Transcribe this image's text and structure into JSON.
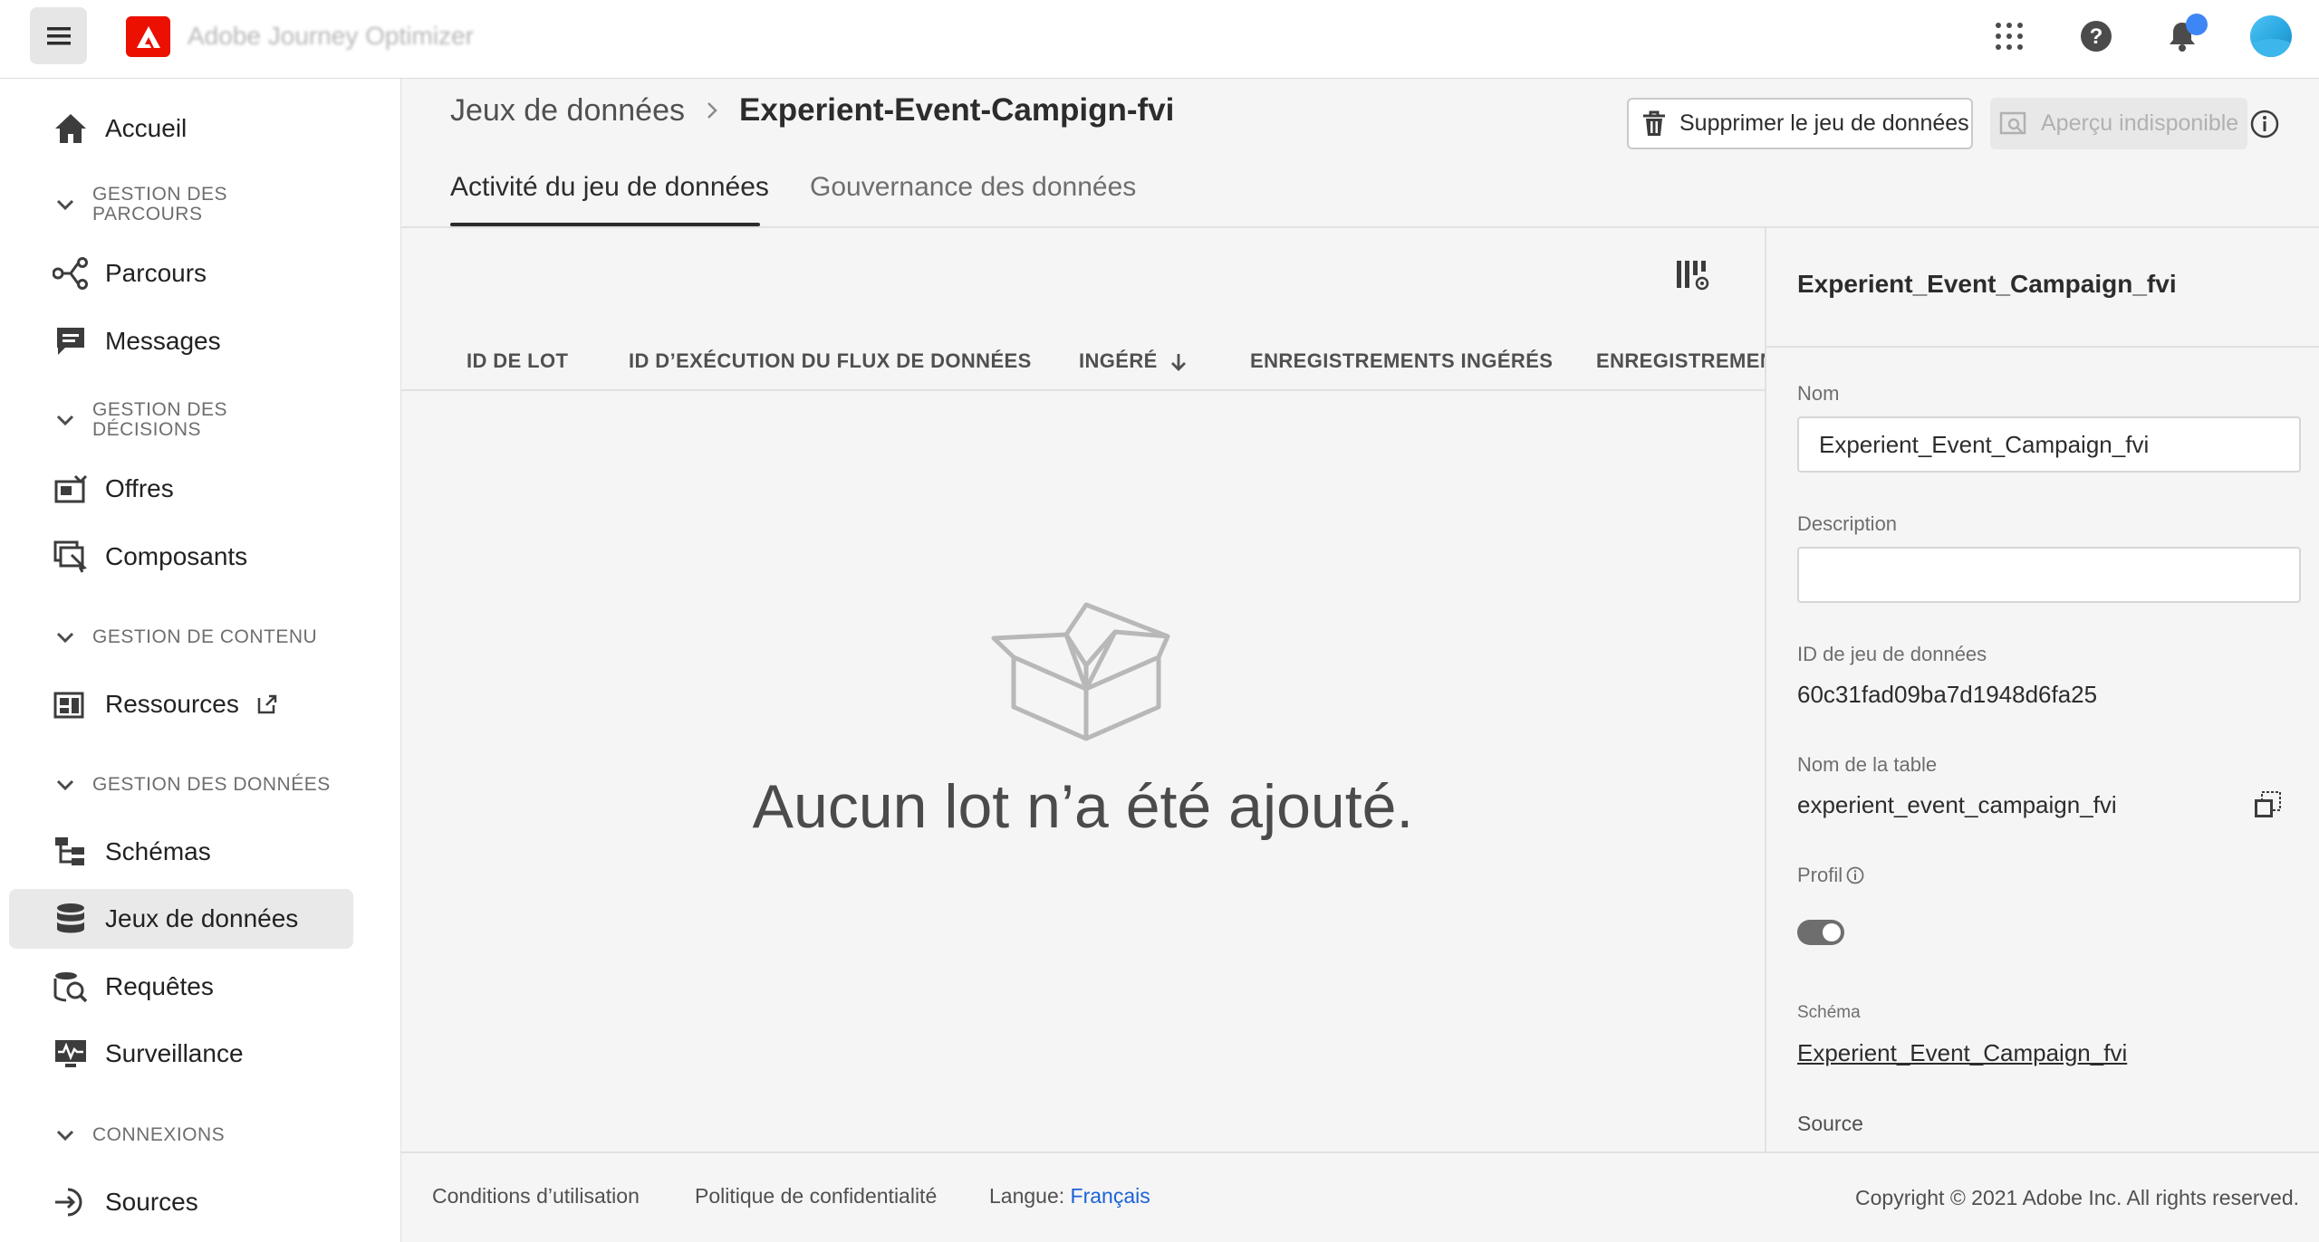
{
  "topbar": {
    "app_title": "Adobe Journey Optimizer",
    "icons": [
      "menu-icon",
      "adobe-logo",
      "apps-grid-icon",
      "help-icon",
      "bell-icon",
      "avatar"
    ]
  },
  "sidebar": {
    "items": [
      {
        "label": "Accueil",
        "icon": "home-icon"
      },
      {
        "section": "GESTION DES PARCOURS"
      },
      {
        "label": "Parcours",
        "icon": "journey-icon"
      },
      {
        "label": "Messages",
        "icon": "message-icon"
      },
      {
        "section": "GESTION DES DÉCISIONS"
      },
      {
        "label": "Offres",
        "icon": "offers-icon"
      },
      {
        "label": "Composants",
        "icon": "components-icon"
      },
      {
        "section": "GESTION DE CONTENU"
      },
      {
        "label": "Ressources",
        "icon": "assets-icon"
      },
      {
        "section": "GESTION DES DONNÉES"
      },
      {
        "label": "Schémas",
        "icon": "schema-icon"
      },
      {
        "label": "Jeux de données",
        "icon": "database-icon"
      },
      {
        "label": "Requêtes",
        "icon": "query-icon"
      },
      {
        "label": "Surveillance",
        "icon": "monitoring-icon"
      },
      {
        "section": "CONNEXIONS"
      },
      {
        "label": "Sources",
        "icon": "sources-icon"
      }
    ],
    "sections": {
      "parcours": "GESTION DES PARCOURS",
      "decisions": "GESTION DES DÉCISIONS",
      "contenu": "GESTION DE CONTENU",
      "donnees": "GESTION DES DONNÉES",
      "connexions": "CONNEXIONS"
    },
    "labels": {
      "accueil": "Accueil",
      "parcours": "Parcours",
      "messages": "Messages",
      "offres": "Offres",
      "composants": "Composants",
      "ressources": "Ressources",
      "schemas": "Schémas",
      "jeux": "Jeux de données",
      "requetes": "Requêtes",
      "surveillance": "Surveillance",
      "sources": "Sources"
    },
    "active": "Jeux de données"
  },
  "header": {
    "breadcrumb_root": "Jeux de données",
    "breadcrumb_current": "Experient-Event-Campign-fvi",
    "delete_label": "Supprimer le jeu de données",
    "preview_label": "Aperçu indisponible"
  },
  "tabs": {
    "activity": "Activité du jeu de données",
    "governance": "Gouvernance des données",
    "selected": "Activité du jeu de données"
  },
  "table": {
    "columns": [
      "ID DE LOT",
      "ID D’EXÉCUTION DU FLUX DE DONNÉES",
      "INGÉRÉ",
      "ENREGISTREMENTS INGÉRÉS",
      "ENREGISTREMEN"
    ],
    "sorted_column": "INGÉRÉ",
    "sort_direction": "descending",
    "empty_message": "Aucun lot n’a été ajouté."
  },
  "panel": {
    "title": "Experient_Event_Campaign_fvi",
    "name_label": "Nom",
    "name_value": "Experient_Event_Campaign_fvi",
    "description_label": "Description",
    "description_value": "",
    "dataset_id_label": "ID de jeu de données",
    "dataset_id_value": "60c31fad09ba7d1948d6fa25",
    "table_name_label": "Nom de la table",
    "table_name_value": "experient_event_campaign_fvi",
    "profile_label": "Profil",
    "profile_enabled": true,
    "schema_label": "Schéma",
    "schema_value": "Experient_Event_Campaign_fvi",
    "source_label": "Source"
  },
  "footer": {
    "terms": "Conditions d’utilisation",
    "privacy": "Politique de confidentialité",
    "language_label": "Langue:",
    "language_value": "Français",
    "copyright": "Copyright ©  2021 Adobe Inc.  All rights reserved."
  },
  "colors": {
    "accent_blue": "#1a63d6",
    "adobe_red": "#eb1000",
    "notification_dot": "#3d86f5"
  }
}
